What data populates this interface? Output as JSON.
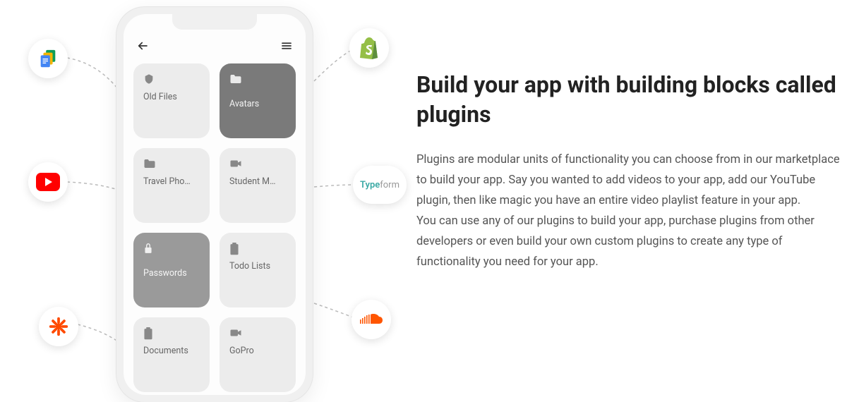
{
  "hero": {
    "heading": "Build your app with building blocks called plugins",
    "paragraph": "Plugins are modular units of functionality you can choose from in our marketplace to build your app. Say you wanted to add videos to your app, add our YouTube plugin, then like magic you have an entire video playlist feature in your app.\nYou can use any of our plugins to build your app, purchase plugins from other developers or even build your own custom plugins to create any type of functionality you need for your app."
  },
  "phone": {
    "cards": [
      {
        "label": "Old Files",
        "icon": "shield",
        "variant": "light"
      },
      {
        "label": "Avatars",
        "icon": "folder",
        "variant": "dark dashed"
      },
      {
        "label": "Travel Pho…",
        "icon": "folder",
        "variant": "light"
      },
      {
        "label": "Student M…",
        "icon": "video",
        "variant": "light"
      },
      {
        "label": "Passwords",
        "icon": "lock",
        "variant": "dark2 dashed"
      },
      {
        "label": "Todo Lists",
        "icon": "clipboard",
        "variant": "light"
      },
      {
        "label": "Documents",
        "icon": "clipboard",
        "variant": "light"
      },
      {
        "label": "GoPro",
        "icon": "video",
        "variant": "light"
      }
    ]
  },
  "badges": {
    "gd": "google-docs-icon",
    "yt": "youtube-icon",
    "zap": "zapier-icon",
    "shop": "shopify-icon",
    "tf_part1": "Type",
    "tf_part2": "form",
    "sc": "soundcloud-icon"
  }
}
